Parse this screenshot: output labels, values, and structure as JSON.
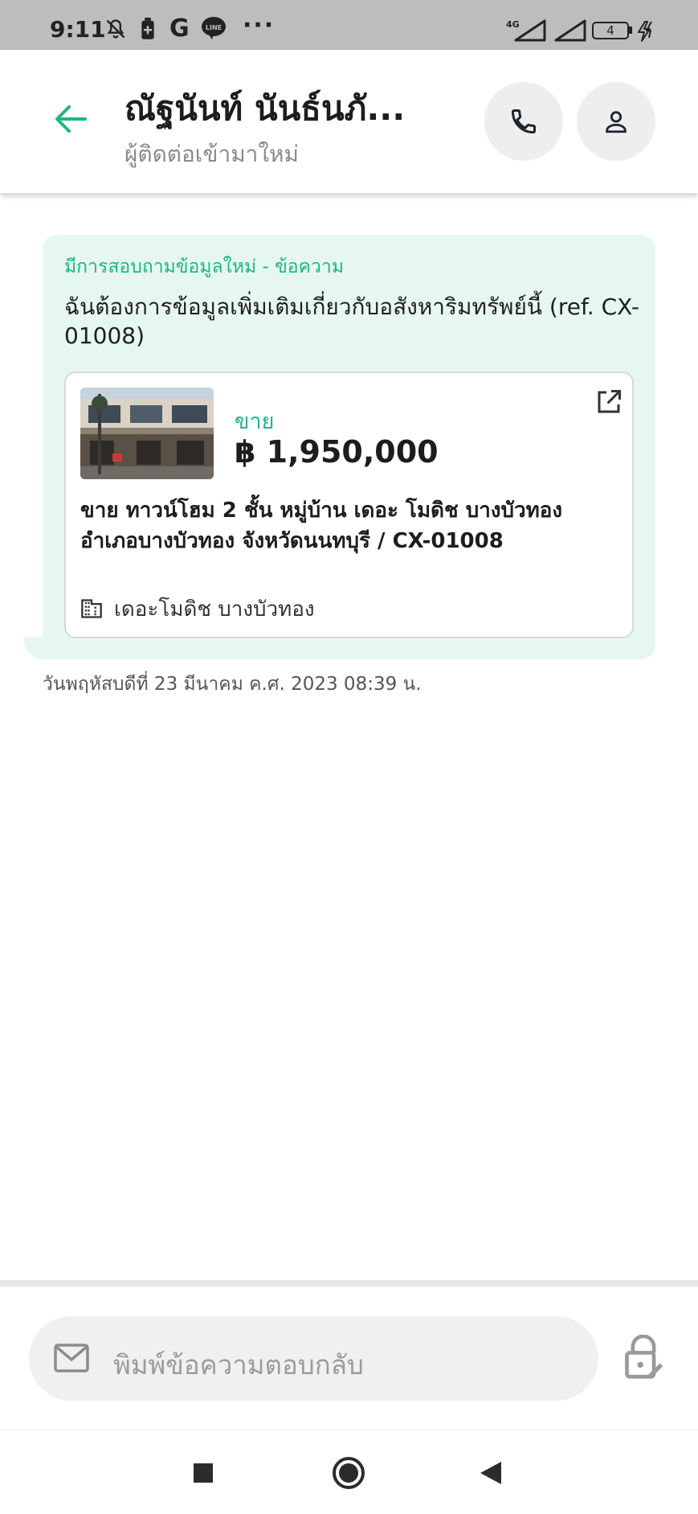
{
  "status_bar": {
    "time": "9:11",
    "network": "4G",
    "battery": "4",
    "icons": [
      "bell-off-icon",
      "battery-saver-icon",
      "google-icon",
      "line-icon",
      "more-icon",
      "signal-icon",
      "signal-icon",
      "battery-icon",
      "charging-icon"
    ]
  },
  "header": {
    "contact_name": "ณัฐนันท์ นันธ์นภั...",
    "contact_subtitle": "ผู้ติดต่อเข้ามาใหม่",
    "accent_color": "#1db685"
  },
  "message": {
    "label": "มีการสอบถามข้อมูลใหม่ - ข้อความ",
    "text": "ฉันต้องการข้อมูลเพิ่มเติมเกี่ยวกับอสังหาริมทรัพย์นี้ (ref. CX-01008)",
    "bubble_color": "#e6f7f1",
    "timestamp": "วันพฤหัสบดีที่ 23 มีนาคม ค.ศ. 2023 08:39 น."
  },
  "listing": {
    "type": "ขาย",
    "price": "฿ 1,950,000",
    "title": "ขาย ทาวน์โฮม 2 ชั้น หมู่บ้าน เดอะ โมดิช บางบัวทอง อำเภอบางบัวทอง จังหวัดนนทบุรี / CX-01008",
    "project": "เดอะโมดิช บางบัวทอง"
  },
  "composer": {
    "placeholder": "พิมพ์ข้อความตอบกลับ"
  }
}
